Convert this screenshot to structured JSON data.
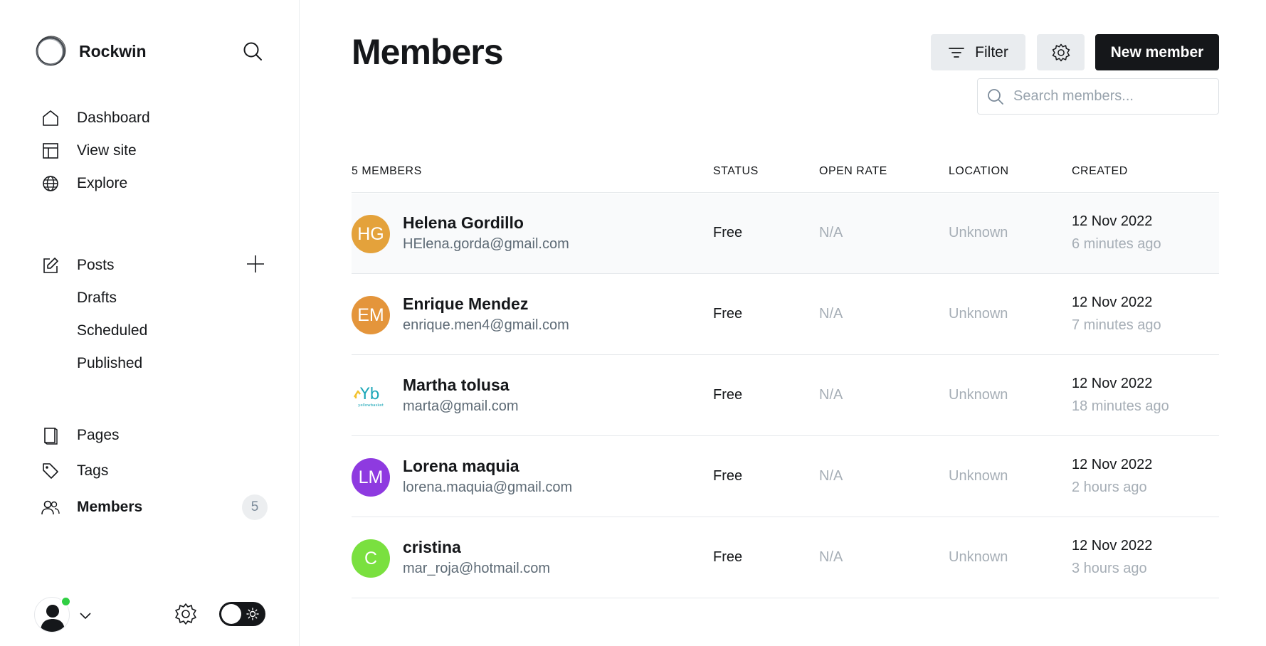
{
  "brand": {
    "name": "Rockwin"
  },
  "sidebar": {
    "primary": [
      {
        "label": "Dashboard",
        "icon": "house-icon"
      },
      {
        "label": "View site",
        "icon": "layout-icon"
      },
      {
        "label": "Explore",
        "icon": "globe-icon"
      }
    ],
    "posts": {
      "label": "Posts",
      "icon": "edit-icon"
    },
    "post_subitems": [
      "Drafts",
      "Scheduled",
      "Published"
    ],
    "secondary": [
      {
        "label": "Pages",
        "icon": "book-icon"
      },
      {
        "label": "Tags",
        "icon": "tag-icon"
      },
      {
        "label": "Members",
        "icon": "users-icon",
        "count": "5",
        "active": true
      }
    ],
    "user": {
      "online": true
    }
  },
  "header": {
    "title": "Members",
    "filter_label": "Filter",
    "new_member_label": "New member",
    "search_placeholder": "Search members..."
  },
  "table": {
    "columns": [
      "5 MEMBERS",
      "STATUS",
      "OPEN RATE",
      "LOCATION",
      "CREATED"
    ],
    "rows": [
      {
        "initials": "HG",
        "avatar_color": "#e4a23b",
        "name": "Helena Gordillo",
        "email": "HElena.gorda@gmail.com",
        "status": "Free",
        "open_rate": "N/A",
        "location": "Unknown",
        "created_date": "12 Nov 2022",
        "created_ago": "6 minutes ago"
      },
      {
        "initials": "EM",
        "avatar_color": "#e4953b",
        "name": "Enrique Mendez",
        "email": "enrique.men4@gmail.com",
        "status": "Free",
        "open_rate": "N/A",
        "location": "Unknown",
        "created_date": "12 Nov 2022",
        "created_ago": "7 minutes ago"
      },
      {
        "initials": "Yb",
        "avatar_color": "#ffffff",
        "avatar_caption": "yellowbasket",
        "name": "Martha tolusa",
        "email": "marta@gmail.com",
        "status": "Free",
        "open_rate": "N/A",
        "location": "Unknown",
        "created_date": "12 Nov 2022",
        "created_ago": "18 minutes ago"
      },
      {
        "initials": "LM",
        "avatar_color": "#8e3ae0",
        "name": "Lorena maquia",
        "email": "lorena.maquia@gmail.com",
        "status": "Free",
        "open_rate": "N/A",
        "location": "Unknown",
        "created_date": "12 Nov 2022",
        "created_ago": "2 hours ago"
      },
      {
        "initials": "C",
        "avatar_color": "#7ae03f",
        "name": "cristina",
        "email": "mar_roja@hotmail.com",
        "status": "Free",
        "open_rate": "N/A",
        "location": "Unknown",
        "created_date": "12 Nov 2022",
        "created_ago": "3 hours ago"
      }
    ]
  }
}
